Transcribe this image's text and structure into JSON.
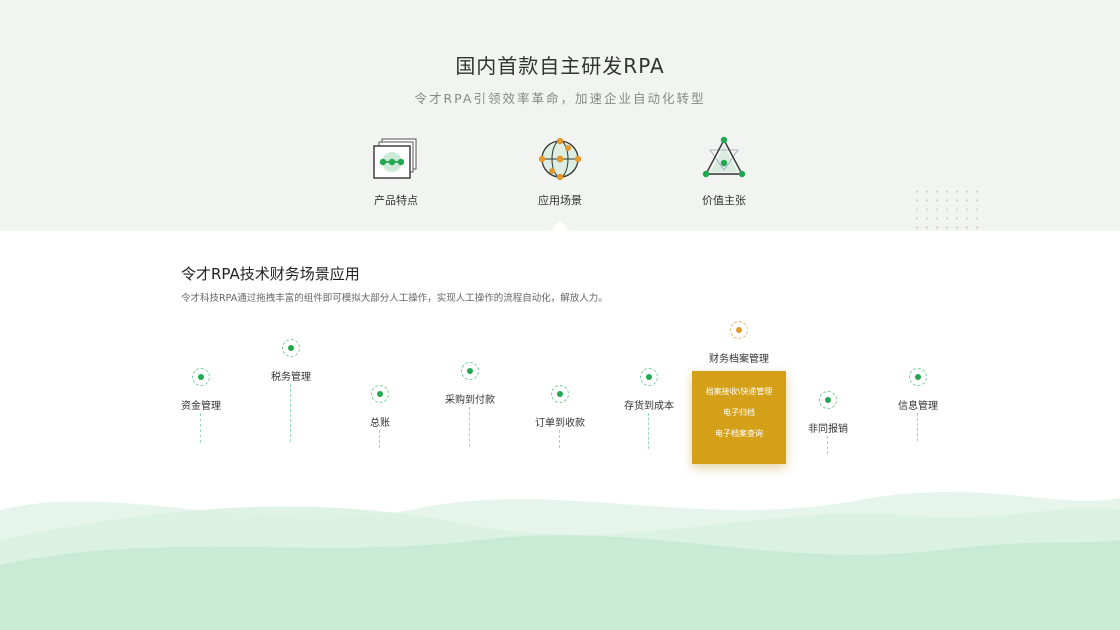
{
  "hero": {
    "title": "国内首款自主研发RPA",
    "subtitle": "令才RPA引领效率革命，加速企业自动化转型",
    "features": [
      {
        "label": "产品特点",
        "icon": "product-features-icon"
      },
      {
        "label": "应用场景",
        "icon": "globe-nodes-icon",
        "active": true
      },
      {
        "label": "价值主张",
        "icon": "triangle-nodes-icon"
      }
    ]
  },
  "section": {
    "title": "令才RPA技术财务场景应用",
    "description": "令才科技RPA通过拖拽丰富的组件即可模拟大部分人工操作，实现人工操作的流程自动化，解放人力。"
  },
  "timeline": {
    "nodes": [
      {
        "label": "资金管理"
      },
      {
        "label": "税务管理"
      },
      {
        "label": "总账"
      },
      {
        "label": "采购到付款"
      },
      {
        "label": "订单到收款"
      },
      {
        "label": "存货到成本"
      },
      {
        "label": "财务档案管理",
        "active": true
      },
      {
        "label": "非同报销"
      },
      {
        "label": "信息管理"
      }
    ],
    "popup": {
      "items": [
        "档案接收\\快递管理",
        "电子归档",
        "电子档案查询"
      ]
    }
  },
  "colors": {
    "green": "#1fa84f",
    "orange": "#d4a017",
    "hero_bg": "#f2f4f2",
    "wave": "#c9ebd6"
  }
}
